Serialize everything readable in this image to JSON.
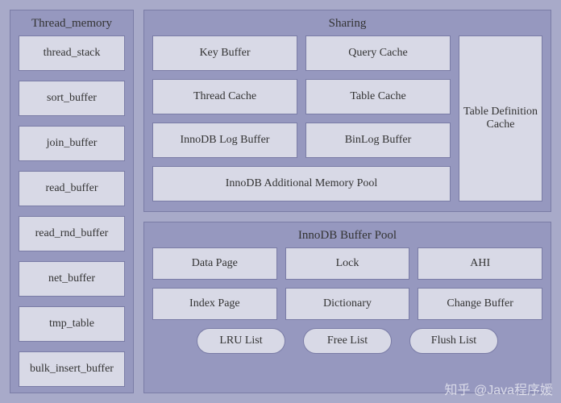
{
  "thread_memory": {
    "title": "Thread_memory",
    "items": [
      "thread_stack",
      "sort_buffer",
      "join_buffer",
      "read_buffer",
      "read_rnd_buffer",
      "net_buffer",
      "tmp_table",
      "bulk_insert_buffer"
    ]
  },
  "sharing": {
    "title": "Sharing",
    "grid": [
      "Key Buffer",
      "Query Cache",
      "Thread Cache",
      "Table Cache",
      "InnoDB Log Buffer",
      "BinLog Buffer"
    ],
    "wide": "InnoDB Additional Memory Pool",
    "side": "Table Definition Cache"
  },
  "innodb": {
    "title": "InnoDB Buffer Pool",
    "grid": [
      "Data Page",
      "Lock",
      "AHI",
      "Index Page",
      "Dictionary",
      "Change Buffer"
    ],
    "pills": [
      "LRU List",
      "Free List",
      "Flush List"
    ]
  },
  "watermark": {
    "main": "知乎 @Java程序媛",
    "sub": ""
  }
}
